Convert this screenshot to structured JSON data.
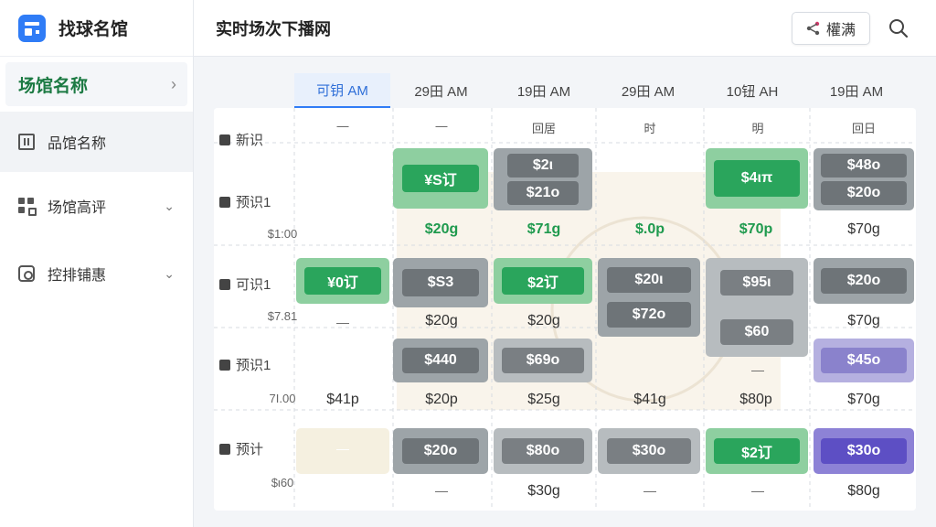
{
  "app": {
    "name": "找球名馆"
  },
  "sidebar": {
    "active": {
      "label": "场馆名称"
    },
    "items": [
      {
        "label": "品馆名称",
        "icon": "store-icon"
      },
      {
        "label": "场馆高评",
        "icon": "grid-icon"
      },
      {
        "label": "控排铺惠",
        "icon": "camera-icon"
      }
    ]
  },
  "header": {
    "title": "实时场次下播网",
    "share_label": "權满"
  },
  "columns": [
    "可钥 AM",
    "29田 AM",
    "19田 AM",
    "29田 AM",
    "10钮 AH",
    "19田 AM"
  ],
  "subheads": [
    "—",
    "—",
    "回居",
    "时",
    "明",
    "回日"
  ],
  "rows": [
    {
      "name": "新识",
      "price": ""
    },
    {
      "name": "预识1",
      "price": "$1:00"
    },
    {
      "name": "可识1",
      "price": "$7.81"
    },
    {
      "name": "预识1",
      "price": "7Ι.00"
    },
    {
      "name": "预计",
      "price": "$ι60"
    }
  ],
  "cells": {
    "r1": {
      "c1_pill": "¥S订",
      "c1_price": "$20g",
      "c2_pill_a": "$2ι",
      "c2_pill_b": "$21ο",
      "c2_price": "$71g",
      "c3_price": "$.0p",
      "c4_pill": "$4ιπ",
      "c4_price": "$70p",
      "c5_pill_a": "$48ο",
      "c5_pill_b": "$20ο",
      "c5_price": "$70g"
    },
    "r2": {
      "c0_pill": "¥0订",
      "c1_pill": "$S3",
      "c1_price": "$20g",
      "c2_pill": "$2订",
      "c2_price": "$20g",
      "c3_pill_a": "$20ι",
      "c3_pill_b": "$72ο",
      "c4_pill_a": "$95ι",
      "c4_pill_b": "$60",
      "c5_pill": "$20ο",
      "c5_price": "$70g"
    },
    "r3": {
      "c0_price": "$41p",
      "c1_pill": "$440",
      "c1_price": "$20p",
      "c2_pill": "$69ο",
      "c2_price": "$25g",
      "c3_price": "$41g",
      "c4_price": "$80p",
      "c5_pill": "$45ο",
      "c5_price": "$70g"
    },
    "r4": {
      "c1_pill": "$20ο",
      "c2_pill": "$80ο",
      "c2_price": "$30g",
      "c3_pill": "$30ο",
      "c4_pill": "$2订",
      "c5_pill": "$30ο",
      "c5_price": "$80g"
    }
  },
  "dash": "—"
}
